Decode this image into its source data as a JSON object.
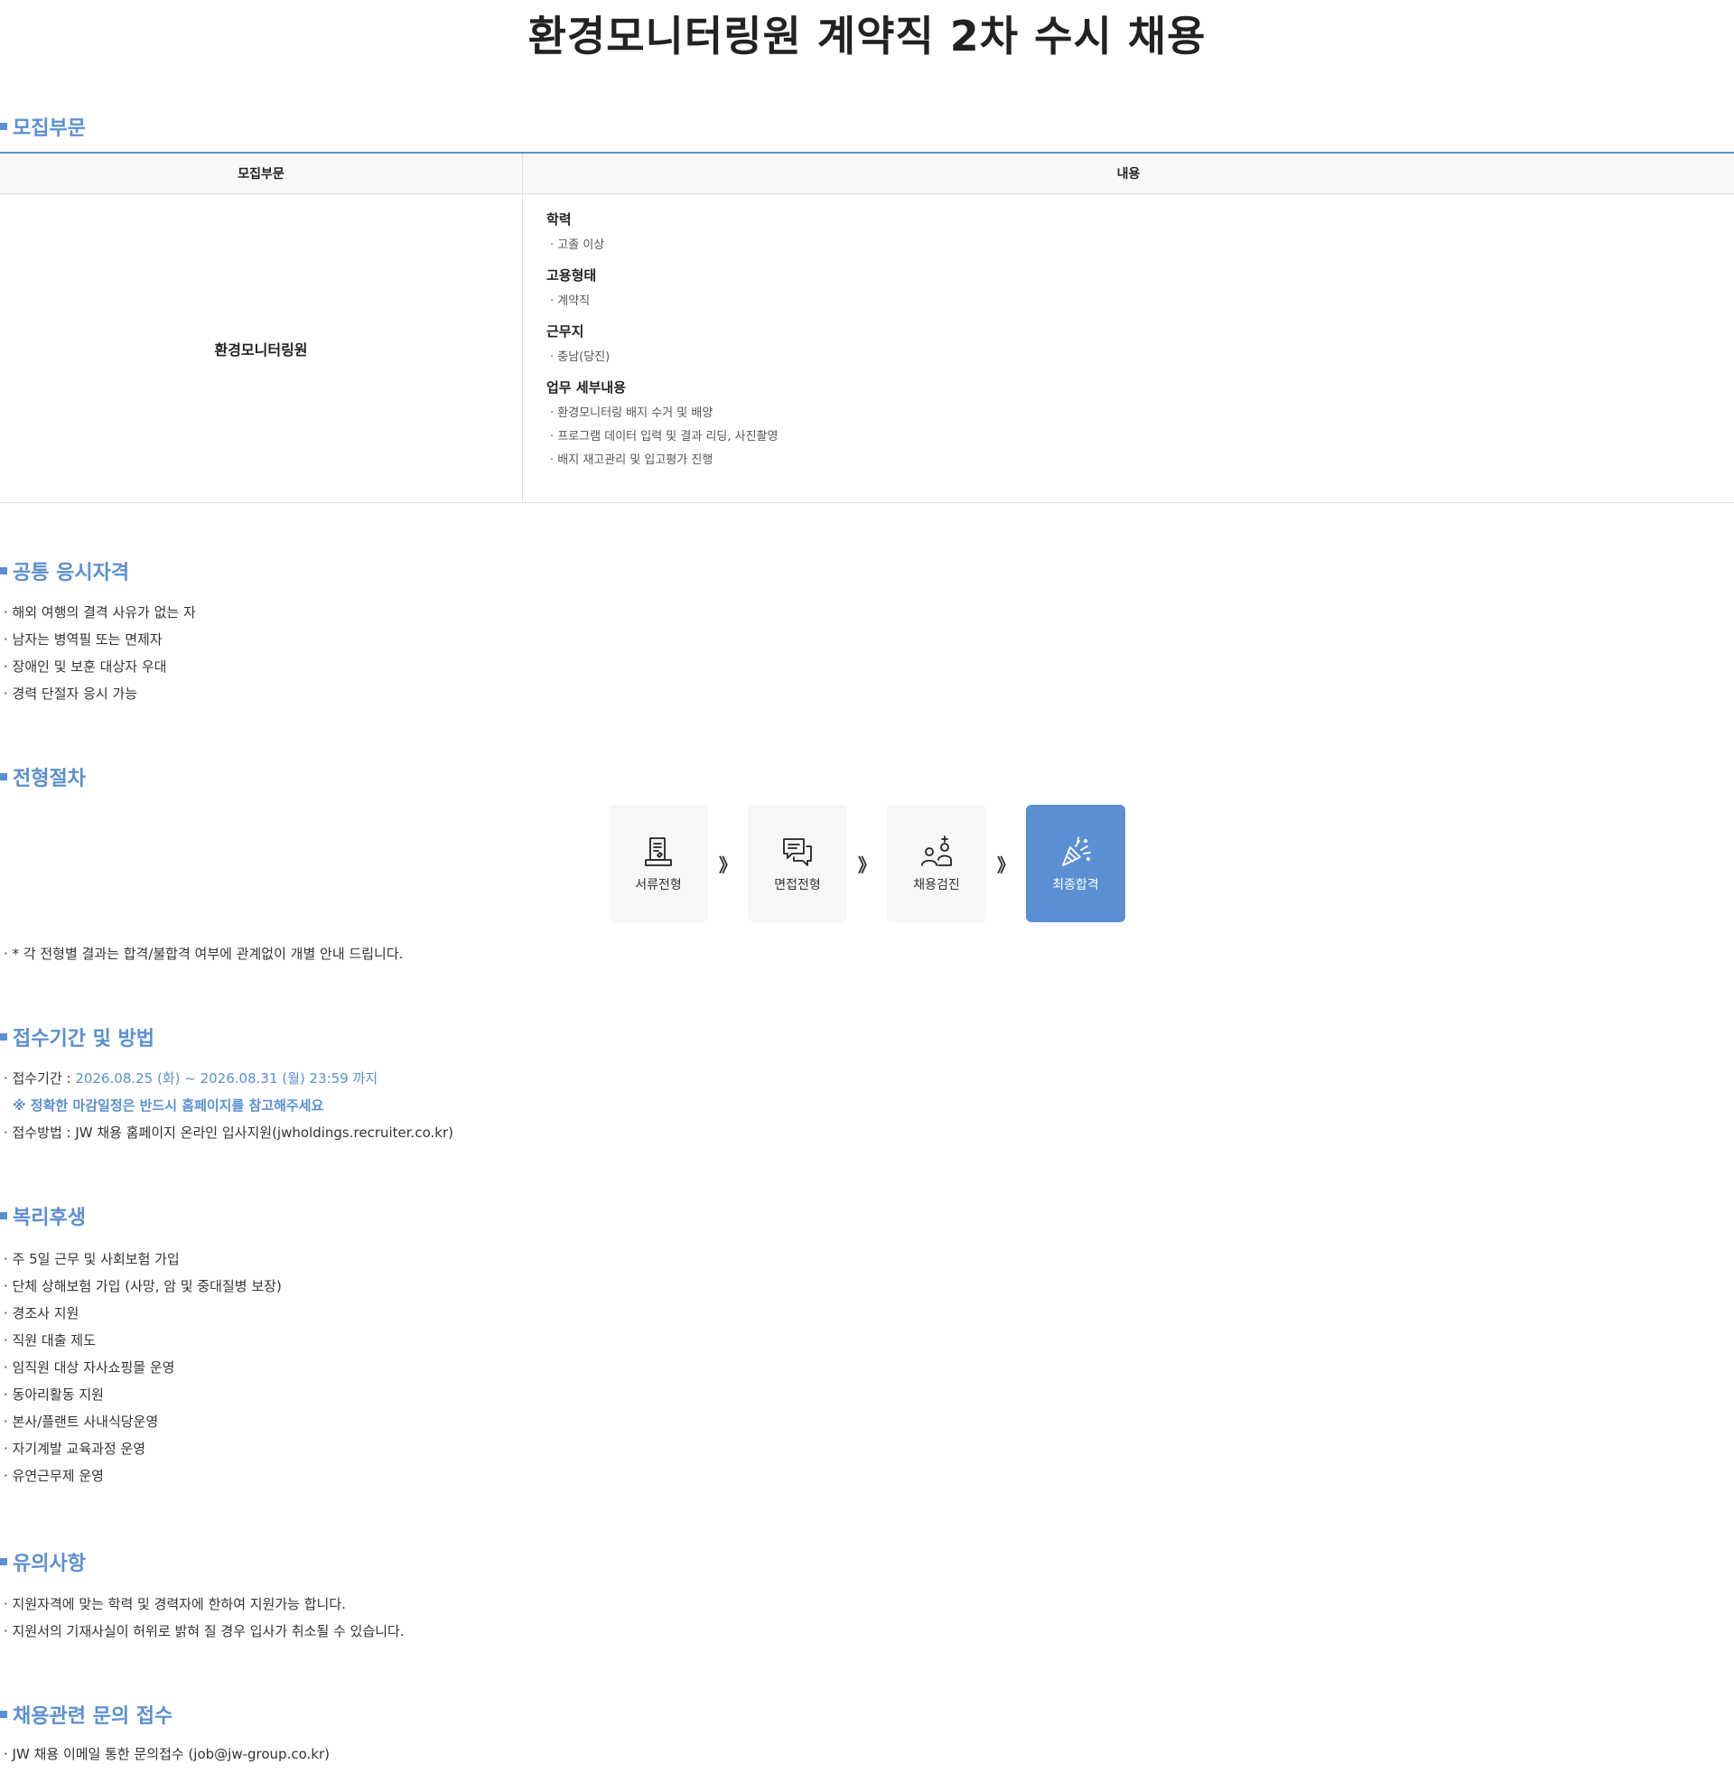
{
  "title": "환경모니터링원 계약직 2차 수시 채용",
  "recruit": {
    "heading": "모집부문",
    "header_division": "모집부문",
    "header_content": "내용",
    "division": "환경모니터링원",
    "details": [
      {
        "label": "학력",
        "items": [
          "고졸 이상"
        ]
      },
      {
        "label": "고용형태",
        "items": [
          "계약직"
        ]
      },
      {
        "label": "근무지",
        "items": [
          "충남(당진)"
        ]
      },
      {
        "label": "업무 세부내용",
        "items": [
          "환경모니터링 배지 수거 및 배양",
          "프로그램 데이터 입력 및 결과 리딩, 사진촬영",
          "배지 재고관리 및 입고평가 진행"
        ]
      }
    ]
  },
  "qualification": {
    "heading": "공통 응시자격",
    "items": [
      "해외 여행의 결격 사유가 없는 자",
      "남자는 병역필 또는 면제자",
      "장애인 및 보훈 대상자 우대",
      "경력 단절자 응시 가능"
    ]
  },
  "process": {
    "heading": "전형절차",
    "steps": [
      {
        "label": "서류전형",
        "icon": "document-icon"
      },
      {
        "label": "면접전형",
        "icon": "chat-icon"
      },
      {
        "label": "채용검진",
        "icon": "health-check-icon"
      },
      {
        "label": "최종합격",
        "icon": "party-popper-icon"
      }
    ],
    "arrow": "》",
    "note": "* 각 전형별 결과는 합격/불합격 여부에 관계없이 개별 안내 드립니다."
  },
  "application": {
    "heading": "접수기간 및 방법",
    "period_label": "접수기간 : ",
    "period_value": "2026.08.25 (화) ~ 2026.08.31 (월) 23:59 까지",
    "notice": "※ 정확한 마감일정은 반드시 홈페이지를 참고해주세요",
    "method": "접수방법 : JW 채용 홈페이지 온라인 입사지원(jwholdings.recruiter.co.kr)"
  },
  "welfare": {
    "heading": "복리후생",
    "items": [
      "주 5일 근무 및 사회보험 가입",
      "단체 상해보험 가입 (사망, 암 및 중대질병 보장)",
      "경조사 지원",
      "직원 대출 제도",
      "임직원 대상 자사쇼핑몰 운영",
      "동아리활동 지원",
      "본사/플랜트 사내식당운영",
      "자기계발 교육과정 운영",
      "유연근무제 운영"
    ]
  },
  "caution": {
    "heading": "유의사항",
    "items": [
      "지원자격에 맞는 학력 및 경력자에 한하여 지원가능 합니다.",
      "지원서의 기재사실이 허위로 밝혀 질 경우 입사가 취소될 수 있습니다."
    ]
  },
  "inquiry": {
    "heading": "채용관련 문의 접수",
    "items": [
      "JW 채용 이메일 통한 문의접수 (job@jw-group.co.kr)"
    ]
  },
  "colors": {
    "accent": "#5b8fd3",
    "step_bg": "#f7f7f7"
  }
}
